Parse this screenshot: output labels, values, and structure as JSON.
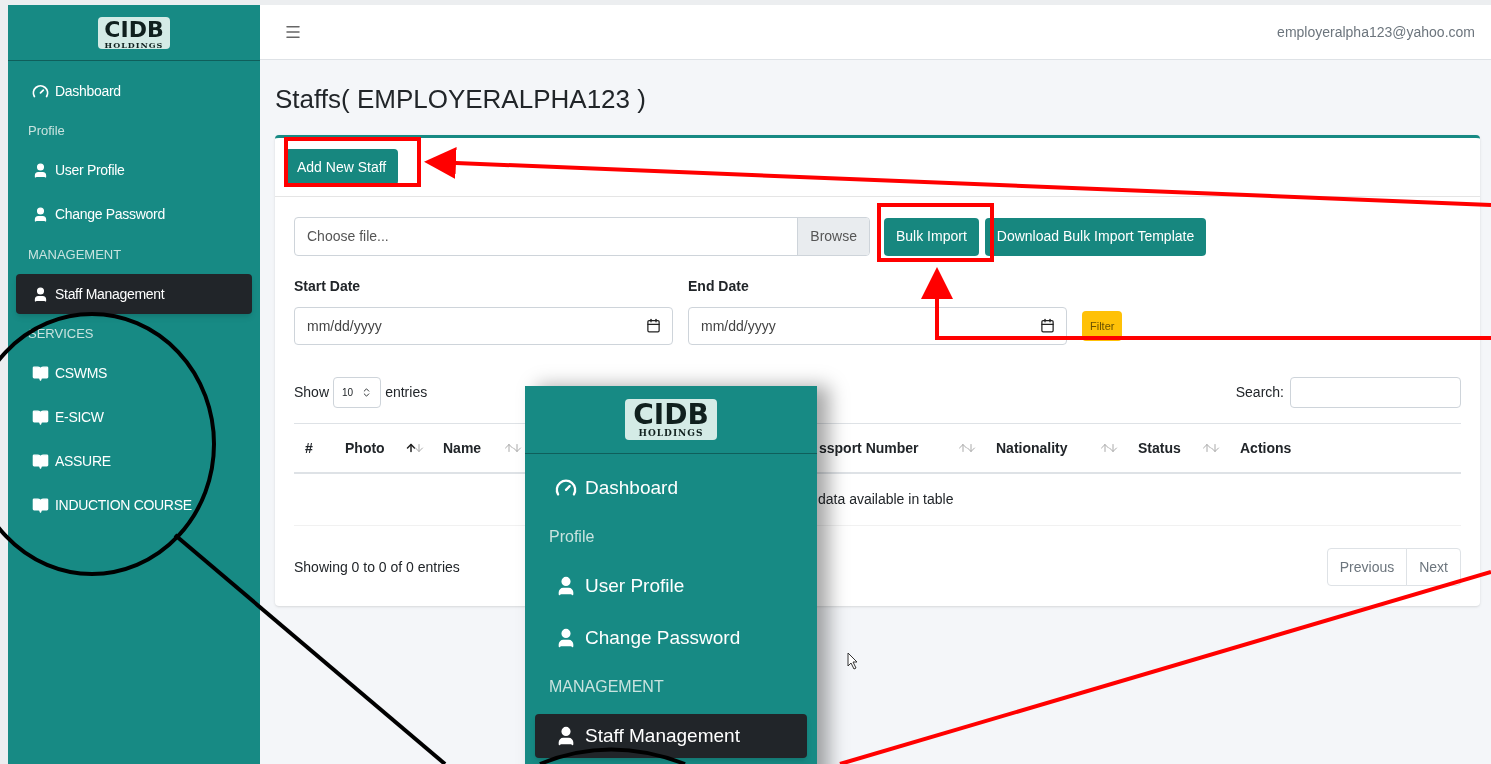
{
  "brand": {
    "name": "CIDB",
    "sub": "HOLDINGS"
  },
  "sidebar": {
    "items": [
      {
        "kind": "dashboard",
        "label": "Dashboard",
        "selected": false
      },
      {
        "kind": "header",
        "label": "Profile"
      },
      {
        "kind": "person",
        "label": "User Profile",
        "selected": false
      },
      {
        "kind": "person",
        "label": "Change Password",
        "selected": false
      },
      {
        "kind": "header",
        "label": "MANAGEMENT"
      },
      {
        "kind": "person",
        "label": "Staff Management",
        "selected": true
      },
      {
        "kind": "header",
        "label": "SERVICES"
      },
      {
        "kind": "book",
        "label": "CSWMS",
        "selected": false
      },
      {
        "kind": "book",
        "label": "E-SICW",
        "selected": false
      },
      {
        "kind": "book",
        "label": "ASSURE",
        "selected": false
      },
      {
        "kind": "book",
        "label": "INDUCTION COURSE",
        "selected": false
      }
    ]
  },
  "topbar": {
    "user_email": "employeralpha123@yahoo.com"
  },
  "page_title": "Staffs( EMPLOYERALPHA123 )",
  "card": {
    "add_button": "Add New Staff",
    "file_input": {
      "placeholder": "Choose file...",
      "browse": "Browse"
    },
    "bulk_import_button": "Bulk Import",
    "template_button": "Download Bulk Import Template",
    "start_date": {
      "label": "Start Date",
      "placeholder": "mm/dd/yyyy"
    },
    "end_date": {
      "label": "End Date",
      "placeholder": "mm/dd/yyyy"
    },
    "filter_button": "Filter"
  },
  "table": {
    "show_label": "Show",
    "page_size": "10",
    "entries_label": "entries",
    "search_label": "Search:",
    "columns": [
      {
        "label": "#",
        "sortable": false,
        "sorted": false
      },
      {
        "label": "Photo",
        "sortable": true,
        "sorted": true
      },
      {
        "label": "Name",
        "sortable": true,
        "sorted": false
      },
      {
        "label": "ssport Number",
        "sortable": true,
        "sorted": false
      },
      {
        "label": "Nationality",
        "sortable": true,
        "sorted": false
      },
      {
        "label": "Status",
        "sortable": true,
        "sorted": false
      },
      {
        "label": "Actions",
        "sortable": false,
        "sorted": false
      }
    ],
    "empty_message": "data available in table",
    "info": "Showing 0 to 0 of 0 entries",
    "pagination": [
      "Previous",
      "Next"
    ]
  },
  "inset": {
    "brand": {
      "name": "CIDB",
      "sub": "HOLDINGS"
    },
    "items": [
      {
        "kind": "dashboard",
        "label": "Dashboard",
        "selected": false
      },
      {
        "kind": "header",
        "label": "Profile"
      },
      {
        "kind": "person",
        "label": "User Profile",
        "selected": false
      },
      {
        "kind": "person",
        "label": "Change Password",
        "selected": false
      },
      {
        "kind": "header",
        "label": "MANAGEMENT"
      },
      {
        "kind": "person",
        "label": "Staff Management",
        "selected": true
      }
    ]
  }
}
